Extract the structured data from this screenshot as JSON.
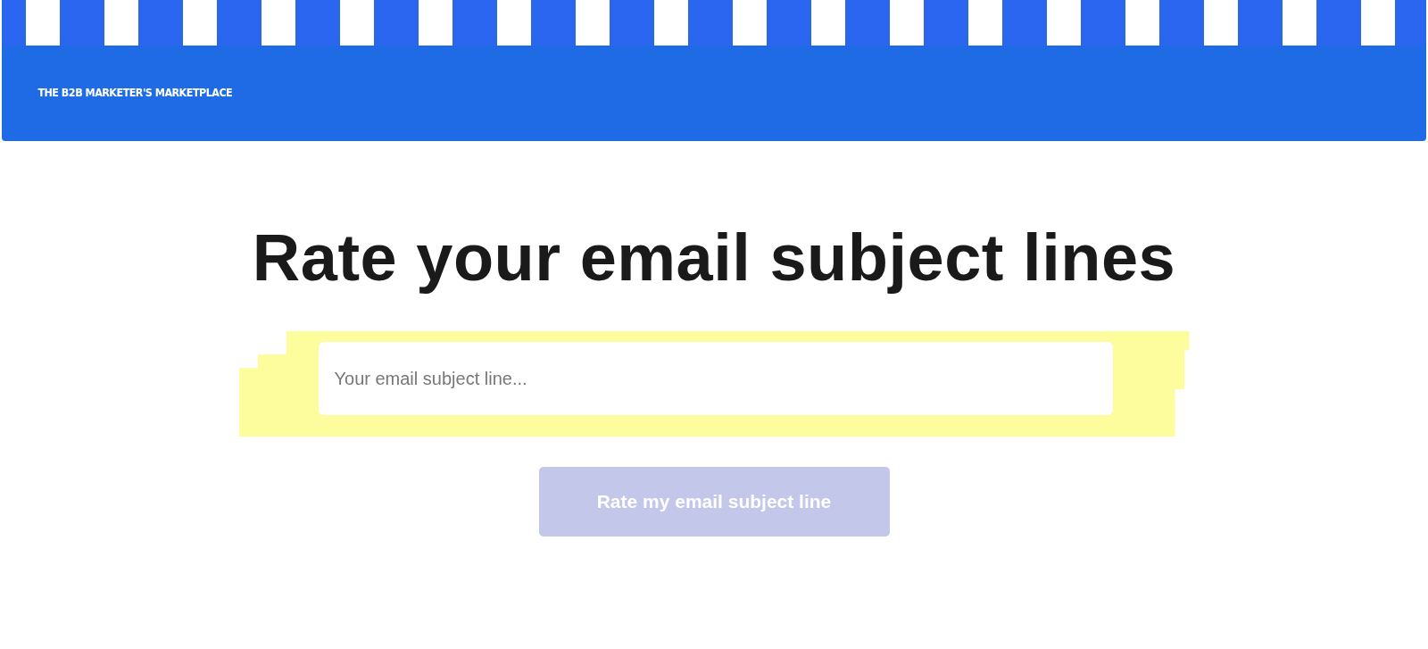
{
  "header": {
    "tagline": "THE B2B MARKETER'S MARKETPLACE"
  },
  "heading": "Rate your email subject lines",
  "subject_field": {
    "placeholder": "Your email subject line..."
  },
  "rate_button": {
    "label": "Rate my email subject line",
    "disabled": true
  }
}
